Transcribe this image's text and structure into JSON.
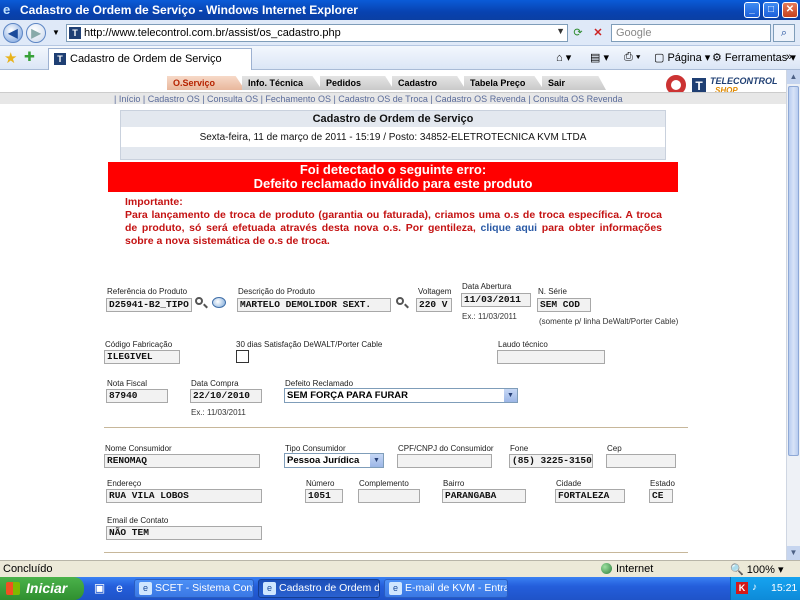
{
  "window": {
    "title": "Cadastro de Ordem de Serviço - Windows Internet Explorer"
  },
  "addressbar": {
    "url": "http://www.telecontrol.com.br/assist/os_cadastro.php",
    "search_placeholder": "Google"
  },
  "commandbar": {
    "tab_label": "Cadastro de Ordem de Serviço",
    "pagina_label": "Página",
    "ferramentas_label": "Ferramentas"
  },
  "menu": {
    "tabs": [
      "O.Serviço",
      "Info. Técnica",
      "Pedidos",
      "Cadastro",
      "Tabela Preço",
      "Sair"
    ],
    "active": 0,
    "sublinks": "| Início | Cadastro OS | Consulta OS | Fechamento OS | Cadastro OS de Troca | Cadastro OS Revenda | Consulta OS Revenda"
  },
  "logo": {
    "line1": "TELECONTROL",
    "line2": "SHOP"
  },
  "header": {
    "title": "Cadastro de Ordem de Serviço",
    "subtitle": "Sexta-feira, 11 de março de 2011 - 15:19 / Posto: 34852-ELETROTECNICA KVM LTDA"
  },
  "error": {
    "line1": "Foi detectado o seguinte erro:",
    "line2": "Defeito reclamado inválido para este produto"
  },
  "notice": {
    "heading": "Importante:",
    "body1": "Para lançamento de troca de produto (garantia ou faturada), criamos uma o.s de troca específica. A troca de produto, só será efetuada através desta nova o.s. Por gentileza,",
    "link": "clique aqui",
    "body2": "para obter informações sobre a nova sistemática de o.s de troca."
  },
  "form": {
    "referencia": {
      "label": "Referência do Produto",
      "value": "D25941-B2_TIPO"
    },
    "descricao": {
      "label": "Descrição do Produto",
      "value": "MARTELO DEMOLIDOR SEXT."
    },
    "voltagem": {
      "label": "Voltagem",
      "value": "220 V"
    },
    "data_abertura": {
      "label": "Data Abertura",
      "value": "11/03/2011",
      "hint": "Ex.: 11/03/2011"
    },
    "n_serie": {
      "label": "N. Série",
      "value": "SEM COD",
      "hint": "(somente p/ linha DeWalt/Porter Cable)"
    },
    "codigo_fabricacao": {
      "label": "Código Fabricação",
      "value": "ILEGIVEL"
    },
    "satisfacao": {
      "label": "30 dias Satisfação DeWALT/Porter Cable",
      "checked": false
    },
    "laudo": {
      "label": "Laudo técnico",
      "value": ""
    },
    "nota_fiscal": {
      "label": "Nota Fiscal",
      "value": "87940"
    },
    "data_compra": {
      "label": "Data Compra",
      "value": "22/10/2010",
      "hint": "Ex.: 11/03/2011"
    },
    "defeito": {
      "label": "Defeito Reclamado",
      "value": "SEM FORÇA PARA FURAR"
    },
    "nome_consumidor": {
      "label": "Nome Consumidor",
      "value": "RENOMAQ"
    },
    "tipo_consumidor": {
      "label": "Tipo Consumidor",
      "value": "Pessoa Jurídica"
    },
    "cpf_cnpj": {
      "label": "CPF/CNPJ do Consumidor",
      "value": ""
    },
    "fone": {
      "label": "Fone",
      "value": "(85) 3225-3150"
    },
    "cep": {
      "label": "Cep",
      "value": ""
    },
    "endereco": {
      "label": "Endereço",
      "value": "RUA VILA LOBOS"
    },
    "numero": {
      "label": "Número",
      "value": "1051"
    },
    "complemento": {
      "label": "Complemento",
      "value": ""
    },
    "bairro": {
      "label": "Bairro",
      "value": "PARANGABA"
    },
    "cidade": {
      "label": "Cidade",
      "value": "FORTALEZA"
    },
    "estado": {
      "label": "Estado",
      "value": "CE"
    },
    "email": {
      "label": "Email de Contato",
      "value": "NÃO TEM"
    }
  },
  "statusbar": {
    "status": "Concluído",
    "zone": "Internet",
    "zoom": "100%"
  },
  "taskbar": {
    "start_label": "Iniciar",
    "tasks": [
      "SCET - Sistema Contr...",
      "Cadastro de Ordem d...",
      "E-mail de KVM - Entra..."
    ],
    "active_task": 1,
    "clock": "15:21"
  }
}
